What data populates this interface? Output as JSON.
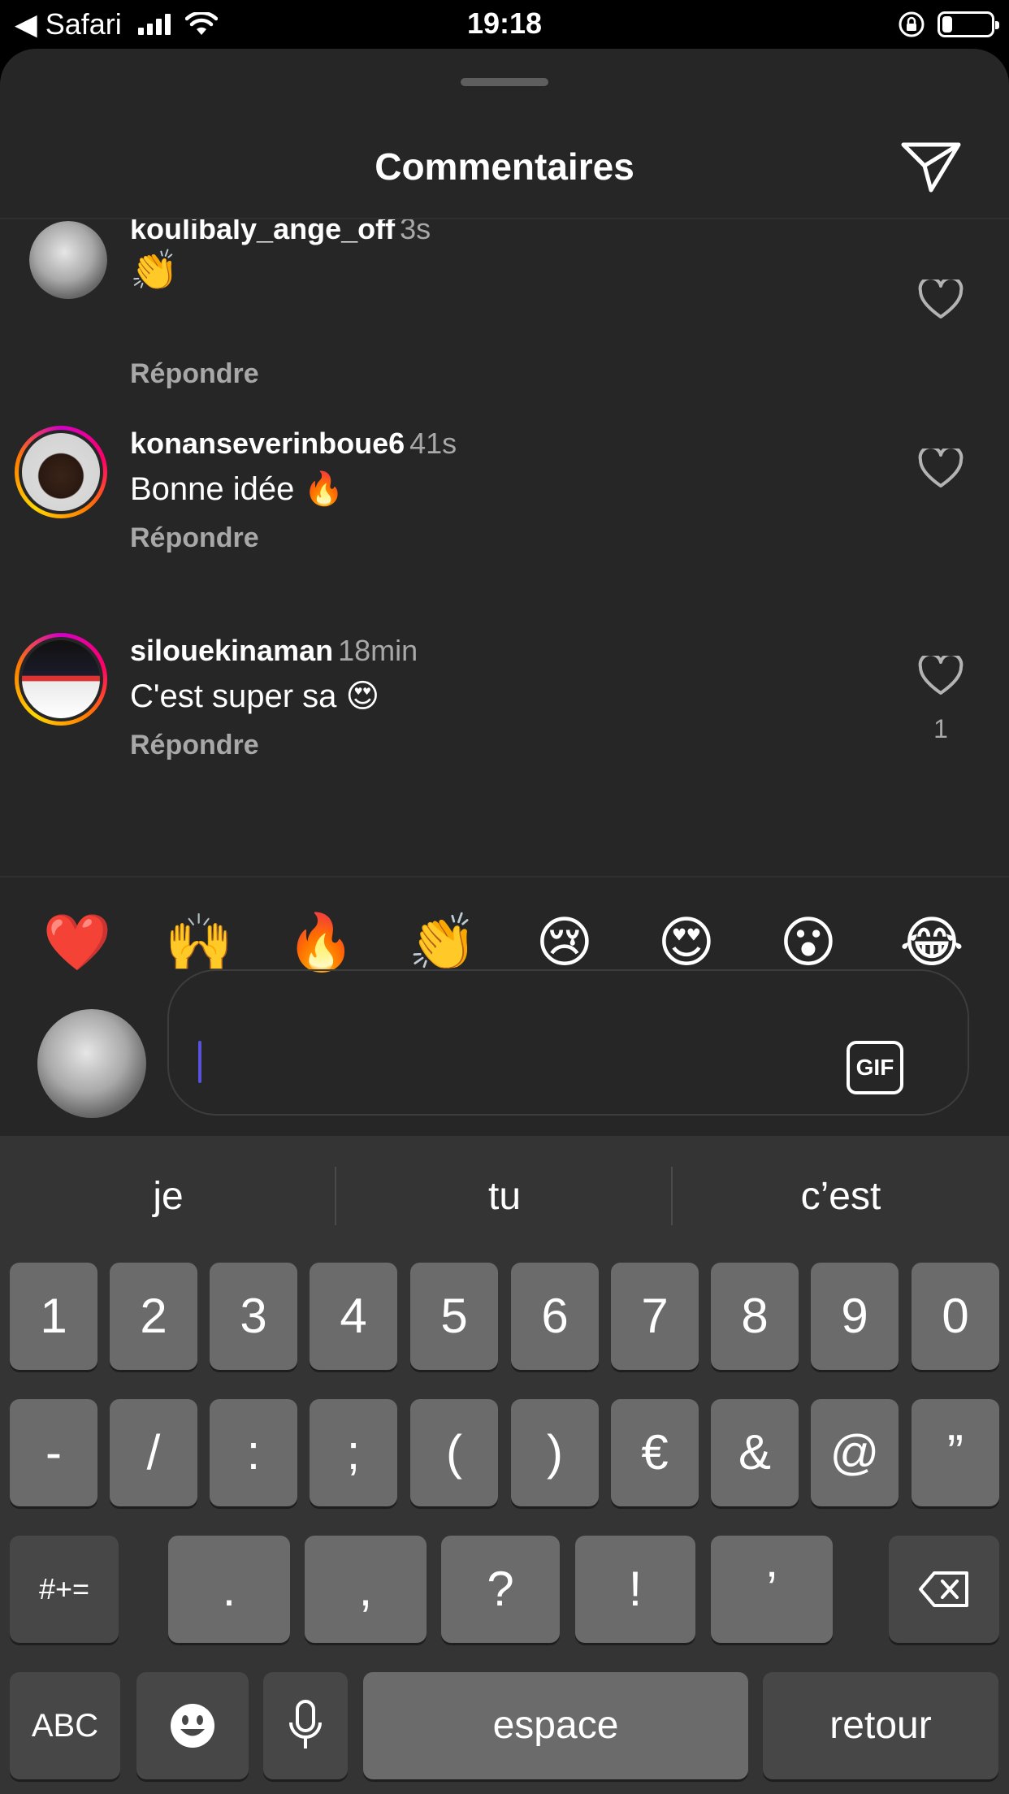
{
  "status_bar": {
    "back_label": "◀ Safari",
    "time": "19:18",
    "battery_level": 0.2
  },
  "header": {
    "title": "Commentaires",
    "send_icon": "paper-plane-icon"
  },
  "comments": [
    {
      "username": "koulibaly_ange_off",
      "time": "3s",
      "text": "👏",
      "reply_label": "Répondre",
      "like_count": ""
    },
    {
      "username": "konanseverinboue6",
      "time": "41s",
      "text": "Bonne idée 🔥",
      "reply_label": "Répondre",
      "like_count": ""
    },
    {
      "username": "silouekinaman",
      "time": "18min",
      "text": "C'est super sa 😍",
      "reply_label": "Répondre",
      "like_count": "1"
    }
  ],
  "quick_reactions": [
    "❤️",
    "🙌",
    "🔥",
    "👏",
    "😢",
    "😍",
    "😮",
    "😂"
  ],
  "composer": {
    "input_value": "",
    "gif_label": "GIF"
  },
  "keyboard": {
    "suggestions": [
      "je",
      "tu",
      "c’est"
    ],
    "row1": [
      "1",
      "2",
      "3",
      "4",
      "5",
      "6",
      "7",
      "8",
      "9",
      "0"
    ],
    "row2": [
      "-",
      "/",
      ":",
      ";",
      "(",
      ")",
      "€",
      "&",
      "@",
      "”"
    ],
    "row3": {
      "shift_label": "#+=",
      "keys": [
        ".",
        ",",
        "?",
        "!",
        "’"
      ],
      "backspace_icon": "backspace-icon"
    },
    "row4": {
      "abc_label": "ABC",
      "emoji_icon": "emoji-icon",
      "mic_icon": "microphone-icon",
      "space_label": "espace",
      "return_label": "retour"
    }
  },
  "colors": {
    "sheet_bg": "#262626",
    "keyboard_bg": "#343434",
    "key_bg": "#6b6b6b",
    "secondary_text": "#a8a8a8",
    "caret": "#5851db"
  }
}
